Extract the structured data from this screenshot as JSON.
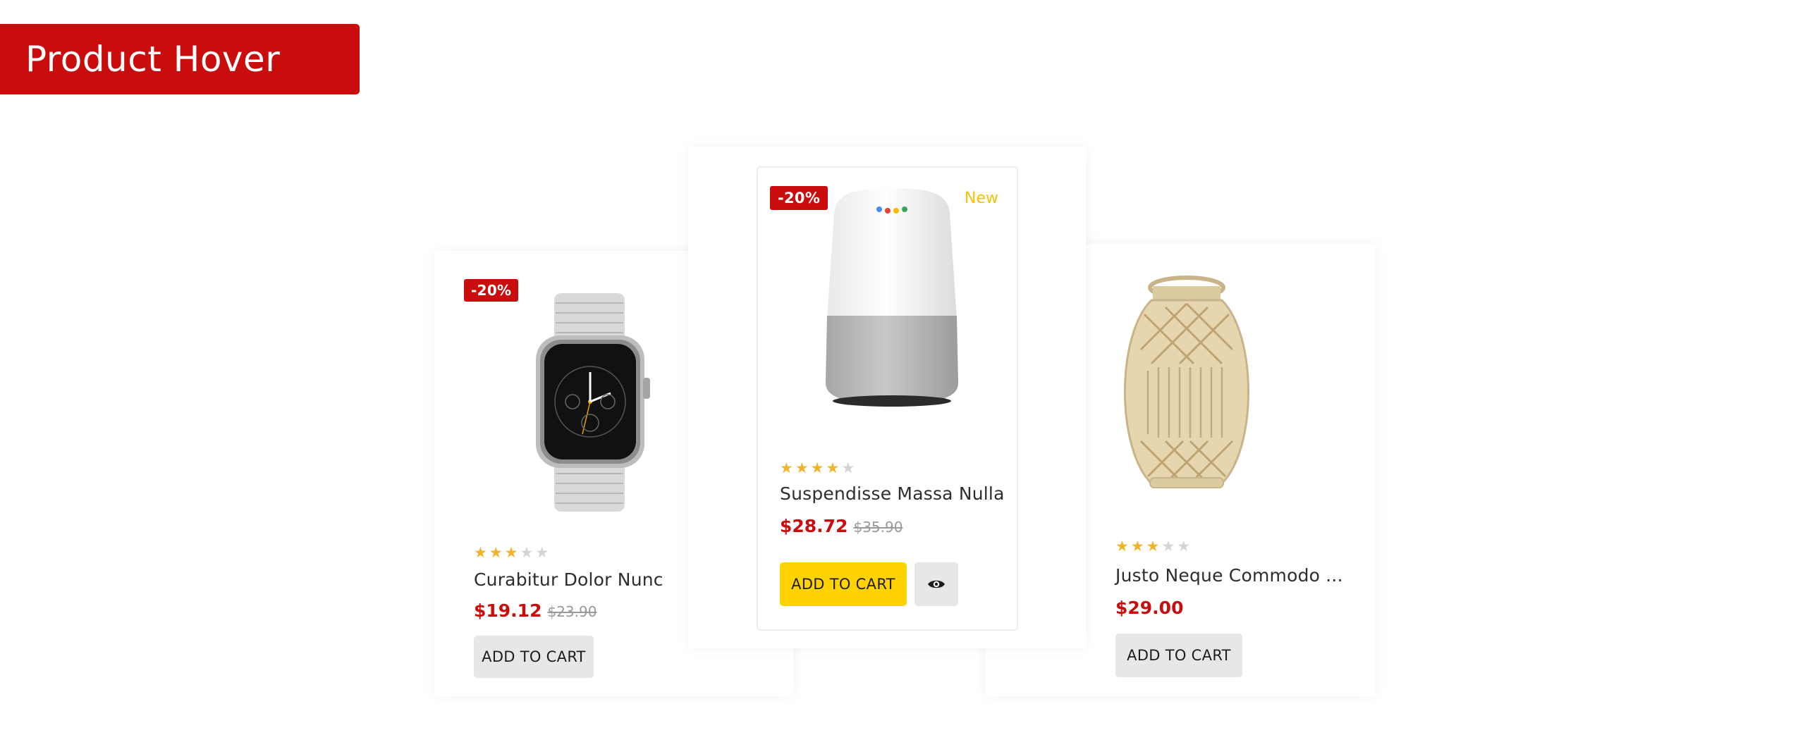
{
  "header": {
    "title": "Product Hover"
  },
  "colors": {
    "brand_red": "#c90d0d",
    "accent_yellow": "#ffd200",
    "star_on": "#f0b429",
    "star_off": "#d4d4d4",
    "new_label": "#f5c10c"
  },
  "products": [
    {
      "name": "Curabitur Dolor Nunc",
      "badge": "-20%",
      "rating": 3,
      "rating_max": 5,
      "price": "$19.12",
      "old_price": "$23.90",
      "button_label": "ADD TO CART",
      "image_icon": "smartwatch-image"
    },
    {
      "name": "Suspendisse Massa Nulla",
      "badge": "-20%",
      "new_label": "New",
      "rating": 4,
      "rating_max": 5,
      "price": "$28.72",
      "old_price": "$35.90",
      "button_label": "ADD TO CART",
      "quickview_icon": "eye-icon",
      "image_icon": "smart-speaker-image"
    },
    {
      "name": "Justo Neque Commodo ...",
      "rating": 3,
      "rating_max": 5,
      "price": "$29.00",
      "button_label": "ADD TO CART",
      "image_icon": "lantern-image"
    }
  ]
}
